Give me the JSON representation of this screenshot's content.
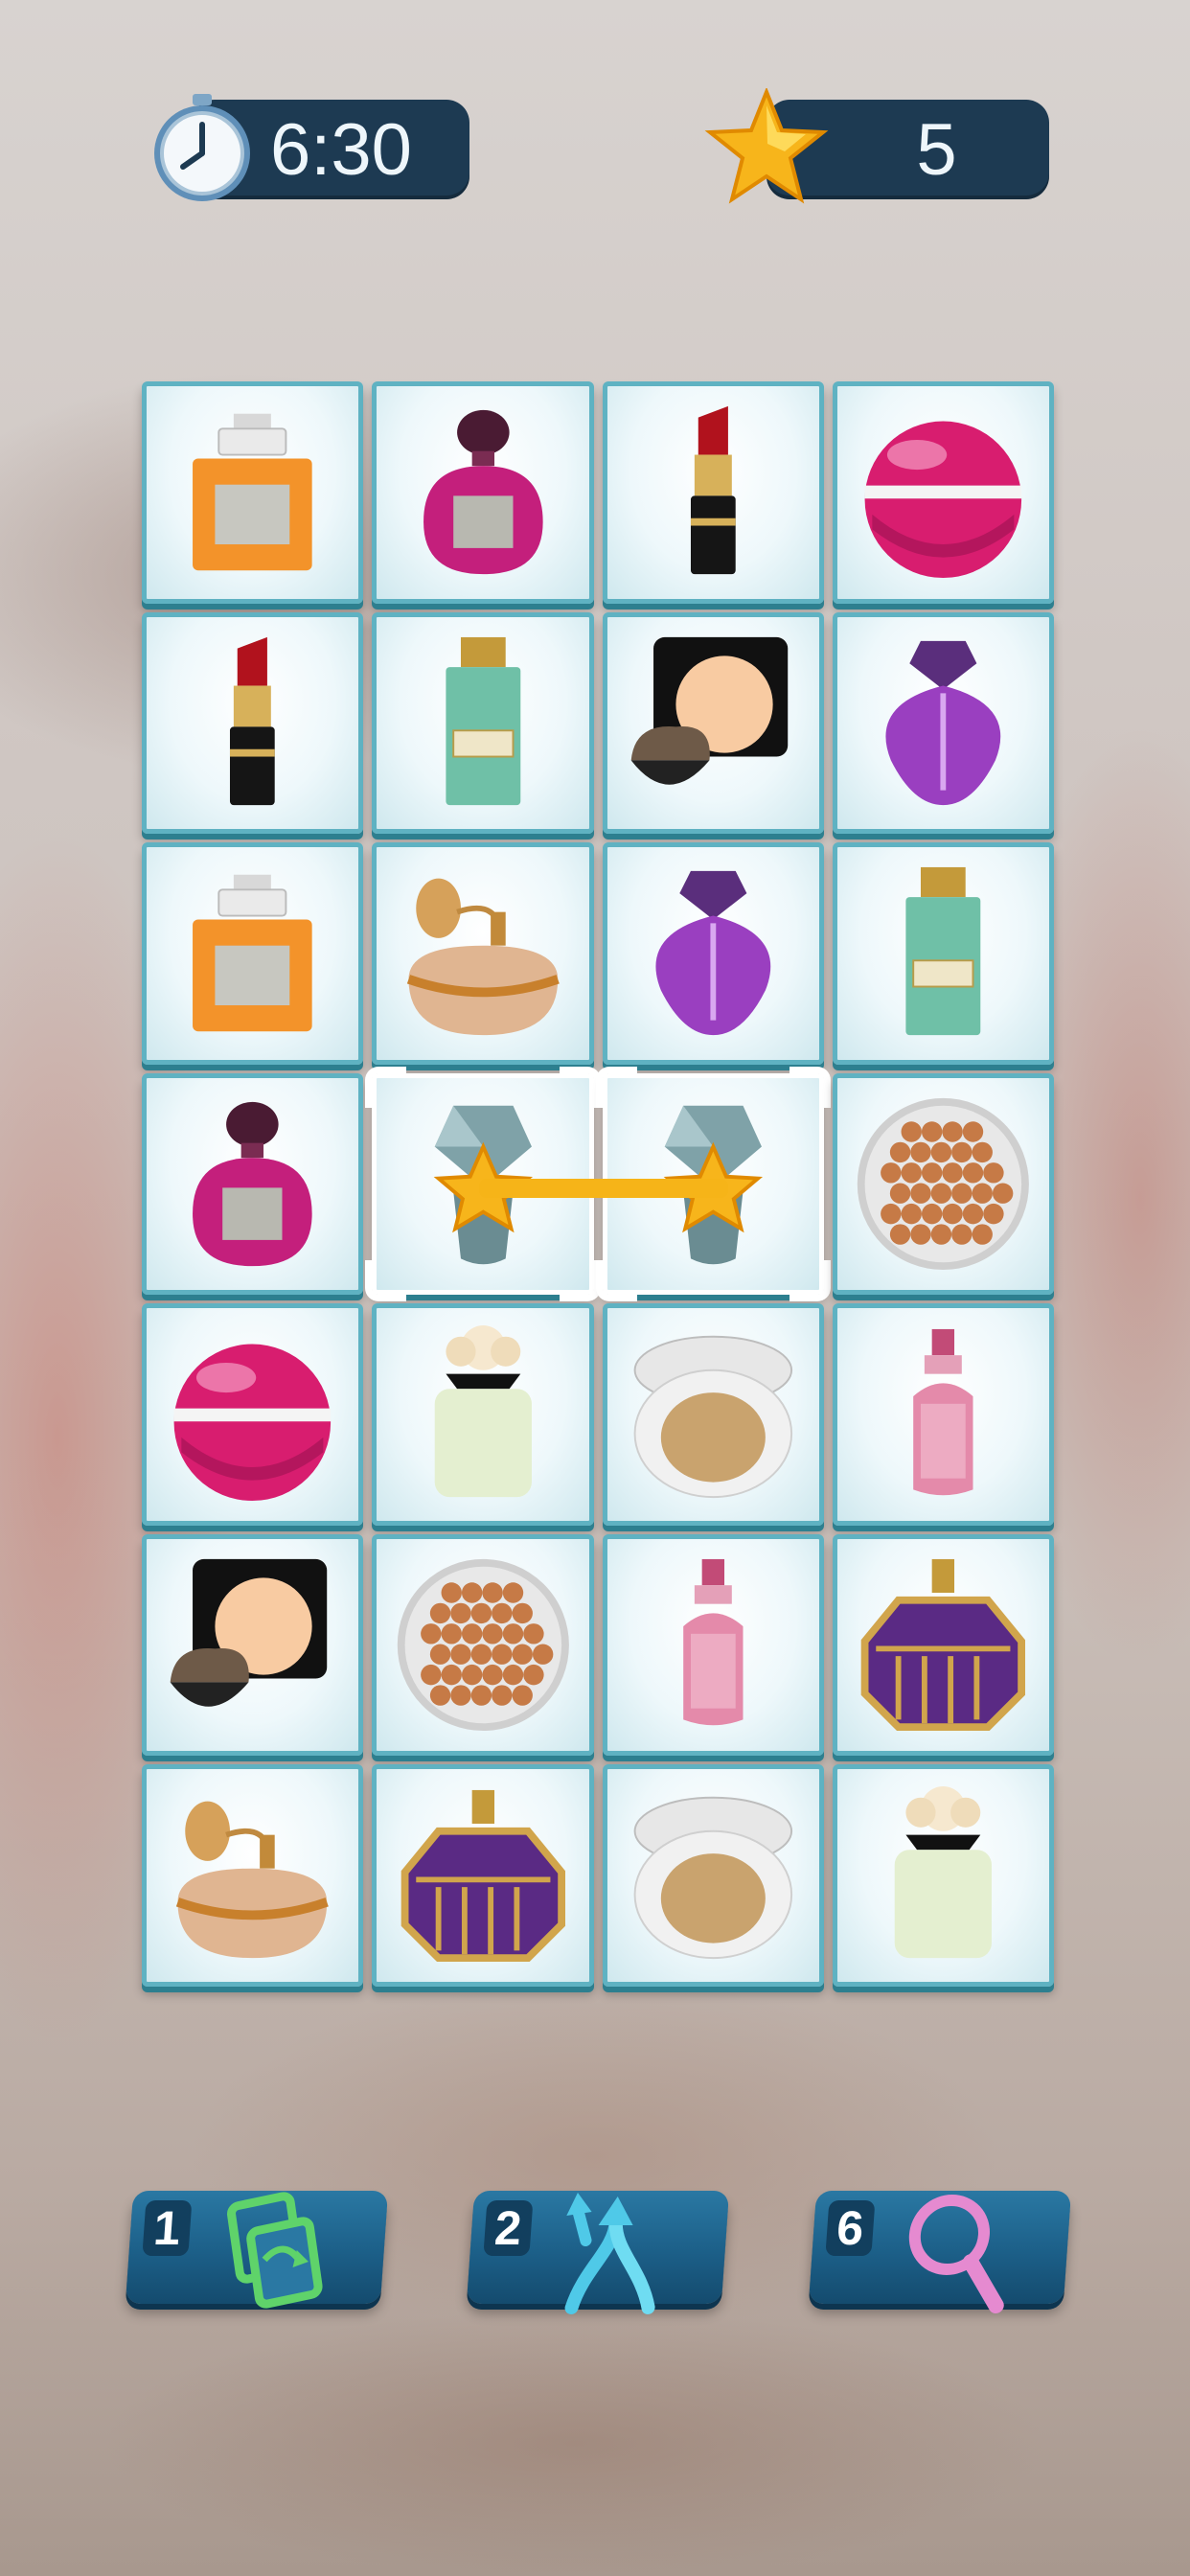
{
  "hud": {
    "timer": "6:30",
    "stars": "5"
  },
  "board": {
    "columns": 4,
    "rows": 7,
    "tiles": [
      [
        "orange-perfume",
        "pink-perfume",
        "red-lipstick",
        "pink-sphere-perfume"
      ],
      [
        "red-lipstick",
        "green-perfume",
        "compact-powder",
        "purple-perfume"
      ],
      [
        "orange-perfume",
        "atomizer-bowl",
        "purple-perfume",
        "green-perfume"
      ],
      [
        "pink-perfume",
        "crystal-perfume",
        "crystal-perfume",
        "bronzing-pearls"
      ],
      [
        "pink-sphere-perfume",
        "floral-perfume",
        "cushion-compact",
        "pink-serum-bottle"
      ],
      [
        "compact-powder",
        "bronzing-pearls",
        "pink-serum-bottle",
        "violet-ornate-perfume"
      ],
      [
        "atomizer-bowl",
        "violet-ornate-perfume",
        "cushion-compact",
        "floral-perfume"
      ]
    ],
    "selected": [
      [
        3,
        1
      ],
      [
        3,
        2
      ]
    ]
  },
  "powerups": [
    {
      "name": "shuffle",
      "count": "1",
      "icon": "shuffle-icon",
      "color": "#5fd36a"
    },
    {
      "name": "hint",
      "count": "2",
      "icon": "crossing-arrows-icon",
      "color": "#4fc9e8"
    },
    {
      "name": "search",
      "count": "6",
      "icon": "magnifier-icon",
      "color": "#e58ad0"
    }
  ],
  "colors": {
    "hud_pill": "#1d3a52",
    "tile_border": "#5fb2c2",
    "link_line": "#f6b418",
    "power_button": "#1c5f88"
  }
}
